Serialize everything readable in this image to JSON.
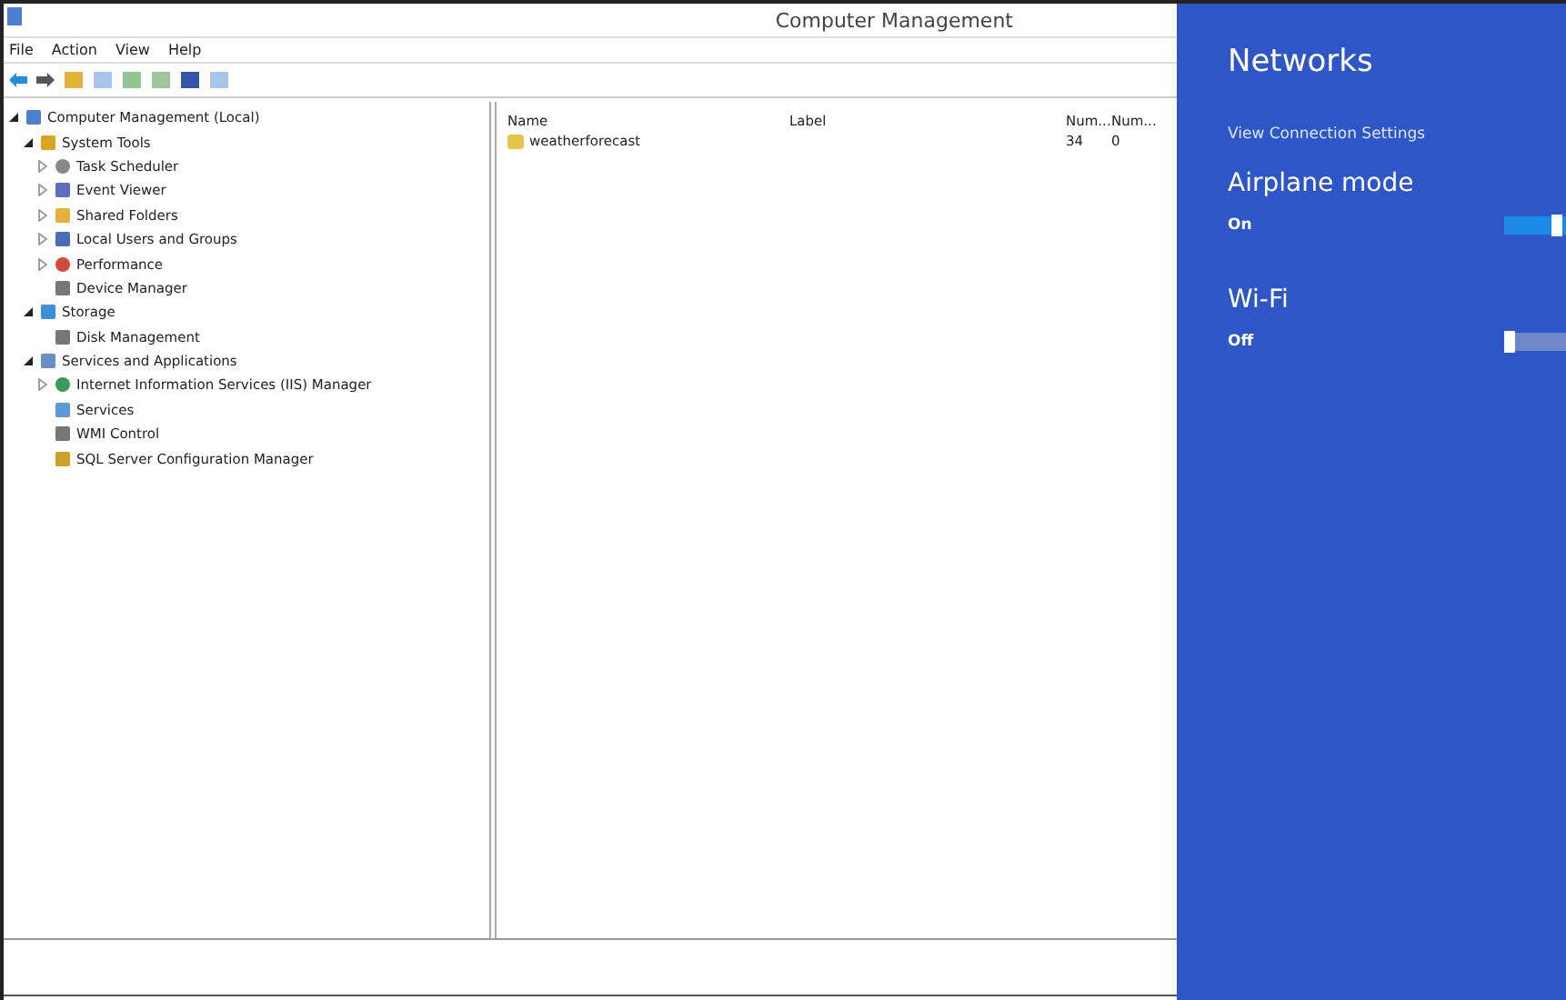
{
  "window": {
    "title": "Computer Management"
  },
  "menu": [
    "File",
    "Action",
    "View",
    "Help"
  ],
  "tree": [
    {
      "label": "Computer Management (Local)",
      "expanded": true,
      "children": [
        {
          "label": "System Tools",
          "expanded": true,
          "children": [
            {
              "label": "Task Scheduler",
              "expanded": false
            },
            {
              "label": "Event Viewer",
              "expanded": false
            },
            {
              "label": "Shared Folders",
              "expanded": false
            },
            {
              "label": "Local Users and Groups",
              "expanded": false
            },
            {
              "label": "Performance",
              "expanded": false
            },
            {
              "label": "Device Manager"
            }
          ]
        },
        {
          "label": "Storage",
          "expanded": true,
          "children": [
            {
              "label": "Disk Management"
            }
          ]
        },
        {
          "label": "Services and Applications",
          "expanded": true,
          "children": [
            {
              "label": "Internet Information Services (IIS) Manager",
              "expanded": false
            },
            {
              "label": "Services"
            },
            {
              "label": "WMI Control"
            },
            {
              "label": "SQL Server Configuration Manager"
            }
          ]
        }
      ]
    }
  ],
  "table": {
    "columns": [
      "Name",
      "Label",
      "Num...",
      "Num..."
    ],
    "rows": [
      [
        "weatherforecast",
        "",
        "34",
        "0"
      ]
    ]
  },
  "networks": {
    "title": "Networks",
    "link": "View Connection Settings",
    "settings": [
      {
        "label": "Airplane mode",
        "state": "On",
        "on": true
      },
      {
        "label": "Wi-Fi",
        "state": "Off",
        "on": false
      }
    ]
  }
}
